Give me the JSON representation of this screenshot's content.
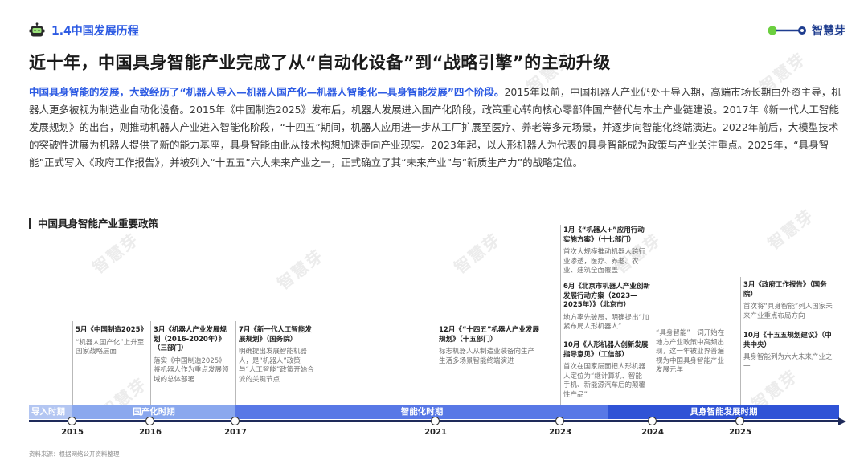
{
  "section": {
    "number_title": "1.4中国发展历程",
    "icon": "robot-icon"
  },
  "brand": {
    "name": "智慧芽",
    "icon": "node-link-logo-icon",
    "color": "#1f3d8f"
  },
  "watermark": "智慧芽",
  "headline": "近十年，中国具身智能产业完成了从“自动化设备”到“战略引擎”的主动升级",
  "intro": {
    "lead": "中国具身智能的发展，大致经历了“机器人导入—机器人国产化—机器人智能化—具身智能发展”四个阶段。",
    "body": "2015年以前，中国机器人产业仍处于导入期，高端市场长期由外资主导，机器人更多被视为制造业自动化设备。2015年《中国制造2025》发布后，机器人发展进入国产化阶段，政策重心转向核心零部件国产替代与本土产业链建设。2017年《新一代人工智能发展规划》的出台，则推动机器人产业进入智能化阶段，“十四五”期间，机器人应用进一步从工厂扩展至医疗、养老等多元场景，并逐步向智能化终端演进。2022年前后，大模型技术的突破性进展为机器人提供了新的能力基座，具身智能由此从技术构想加速走向产业现实。2023年起，以人形机器人为代表的具身智能成为政策与产业关注重点。2025年，“具身智能”正式写入《政府工作报告》，并被列入“十五五”六大未来产业之一，正式确立了其“未来产业”与“新质生产力”的战略定位。"
  },
  "policy_section_title": "中国具身智能产业重要政策",
  "events": {
    "e2015": {
      "title": "5月《中国制造2025》",
      "desc": "“机器人国产化”上升至国家战略层面"
    },
    "e2016": {
      "title": "3月《机器人产业发展规划（2016-2020年）》（三部门）",
      "desc": "落实《中国制造2025》将机器人作为重点发展领域的总体部署"
    },
    "e2017": {
      "title": "7月《新一代人工智能发展规划》（国务院）",
      "desc": "明确提出发展智能机器人，是“机器人”政策与“人工智能”政策开始合流的关键节点"
    },
    "e2021": {
      "title": "12月《“十四五”机器人产业发展规划》（十五部门）",
      "desc": "标志机器人从制造业装备向生产生活多场景智能终端演进"
    },
    "e2023a": {
      "title": "1月《“机器人+”应用行动实施方案》（十七部门）",
      "desc": "首次大规模推动机器人跨行业渗透，医疗、养老、农业、建筑全面覆盖"
    },
    "e2023b": {
      "title": "6月《北京市机器人产业创新发展行动方案（2023—2025年）》（北京市）",
      "desc": "地方率先破局，明确提出“加紧布局人形机器人”"
    },
    "e2023c": {
      "title": "10月《人形机器人创新发展指导意见》（工信部）",
      "desc": "首次在国家层面把人形机器人定位为“继计算机、智能手机、新能源汽车后的颠覆性产品”"
    },
    "e2024": {
      "title": "",
      "desc": "“具身智能”一词开始在地方产业政策中高频出现，这一年被业界普遍视为中国具身智能产业发展元年"
    },
    "e2025a": {
      "title": "3月《政府工作报告》（国务院）",
      "desc": "首次将“具身智能”列入国家未来产业重点布局方向"
    },
    "e2025b": {
      "title": "10月《十五五规划建议》（中共中央）",
      "desc": "具身智能列为六大未来产业之一"
    }
  },
  "phases": [
    {
      "label": "导入时期",
      "color": "#b3c6f2"
    },
    {
      "label": "国产化时期",
      "color": "#8aa8ee"
    },
    {
      "label": "智能化时期",
      "color": "#5878e6"
    },
    {
      "label": "具身智能发展时期",
      "color": "#2f53d6"
    }
  ],
  "years": [
    "2015",
    "2016",
    "2017",
    "2021",
    "2023",
    "2024",
    "2025"
  ],
  "source": "资料来源：根据网络公开资料整理",
  "colors": {
    "accent": "#2d5be3",
    "axis": "#1e2a5a"
  }
}
